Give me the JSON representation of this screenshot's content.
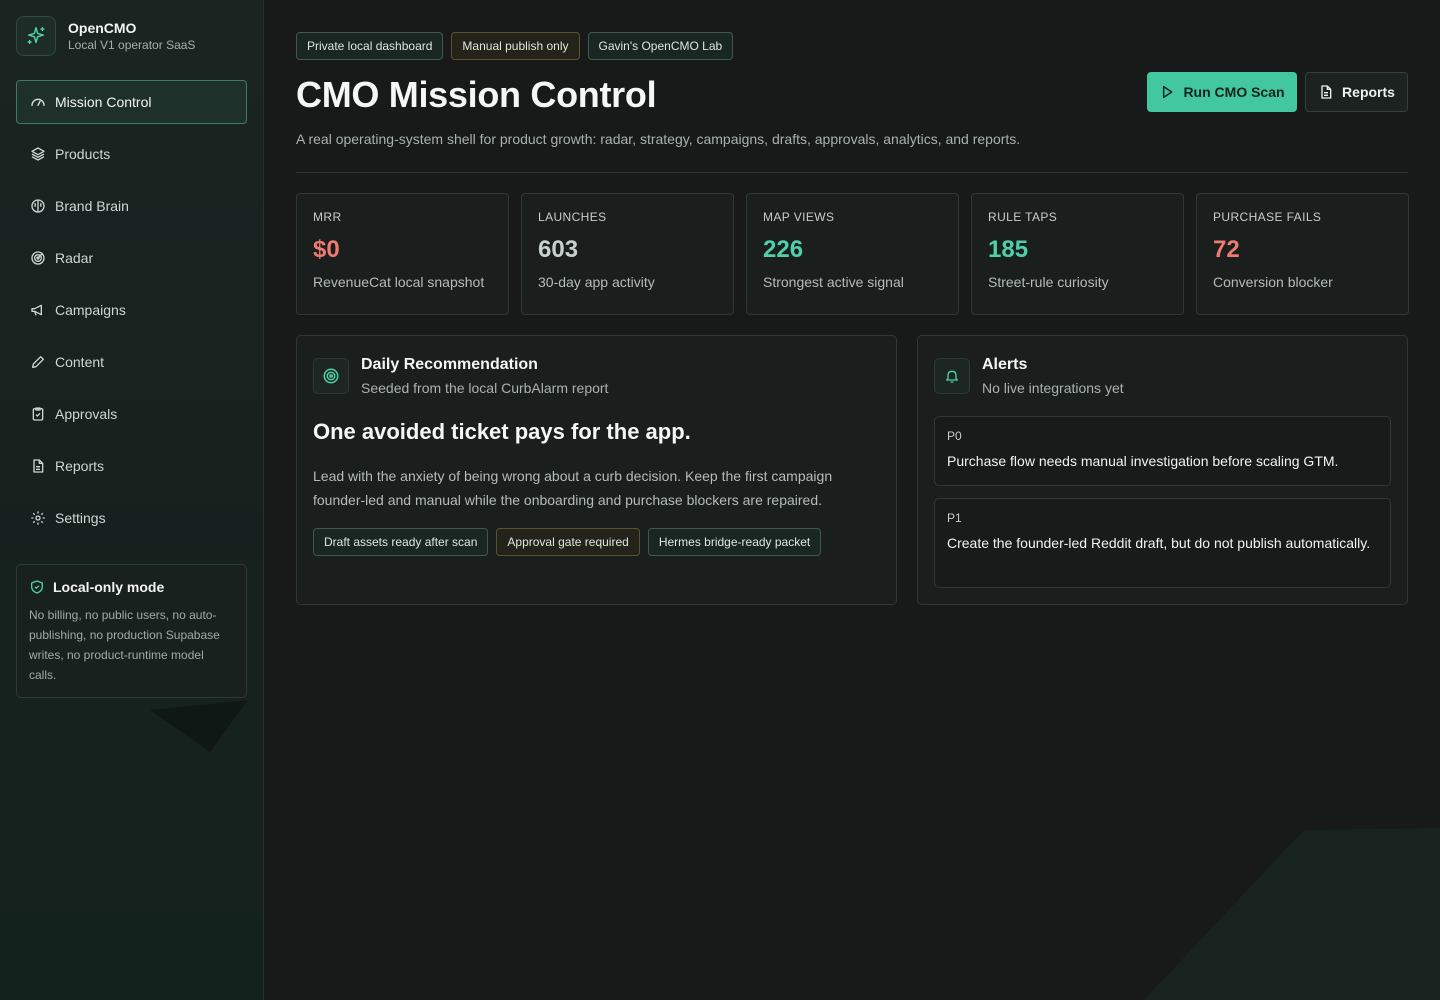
{
  "brand": {
    "name": "OpenCMO",
    "subtitle": "Local V1 operator SaaS"
  },
  "sidebar": {
    "items": [
      {
        "label": "Mission Control",
        "icon": "gauge-icon",
        "active": true
      },
      {
        "label": "Products",
        "icon": "layers-icon"
      },
      {
        "label": "Brand Brain",
        "icon": "brain-icon"
      },
      {
        "label": "Radar",
        "icon": "radar-icon"
      },
      {
        "label": "Campaigns",
        "icon": "megaphone-icon"
      },
      {
        "label": "Content",
        "icon": "pen-icon"
      },
      {
        "label": "Approvals",
        "icon": "clipboard-check-icon"
      },
      {
        "label": "Reports",
        "icon": "file-text-icon"
      },
      {
        "label": "Settings",
        "icon": "gear-icon"
      }
    ],
    "local_mode": {
      "title": "Local-only mode",
      "body": "No billing, no public users, no auto-publishing, no production Supabase writes, no product-runtime model calls."
    }
  },
  "header": {
    "chips": [
      "Private local dashboard",
      "Manual publish only",
      "Gavin's OpenCMO Lab"
    ],
    "title": "CMO Mission Control",
    "description": "A real operating-system shell for product growth: radar, strategy, campaigns, drafts, approvals, analytics, and reports.",
    "primary_button": "Run CMO Scan",
    "secondary_button": "Reports"
  },
  "kpis": [
    {
      "label": "MRR",
      "value": "$0",
      "note": "RevenueCat local snapshot",
      "color": "#ef7a72"
    },
    {
      "label": "LAUNCHES",
      "value": "603",
      "note": "30-day app activity",
      "color": "#c9d1cd"
    },
    {
      "label": "MAP VIEWS",
      "value": "226",
      "note": "Strongest active signal",
      "color": "#4fd1a8"
    },
    {
      "label": "RULE TAPS",
      "value": "185",
      "note": "Street-rule curiosity",
      "color": "#4fd1a8"
    },
    {
      "label": "PURCHASE FAILS",
      "value": "72",
      "note": "Conversion blocker",
      "color": "#ef7a72"
    }
  ],
  "recommendation": {
    "title": "Daily Recommendation",
    "subtitle": "Seeded from the local CurbAlarm report",
    "headline": "One avoided ticket pays for the app.",
    "body": "Lead with the anxiety of being wrong about a curb decision. Keep the first campaign founder-led and manual while the onboarding and purchase blockers are repaired.",
    "chips": [
      "Draft assets ready after scan",
      "Approval gate required",
      "Hermes bridge-ready packet"
    ]
  },
  "alerts": {
    "title": "Alerts",
    "subtitle": "No live integrations yet",
    "items": [
      {
        "priority": "P0",
        "text": "Purchase flow needs manual investigation before scaling GTM."
      },
      {
        "priority": "P1",
        "text": "Create the founder-led Reddit draft, but do not publish automatically."
      }
    ]
  },
  "colors": {
    "accent": "#43c7a0",
    "danger": "#ef7a72",
    "background": "#171a19"
  }
}
